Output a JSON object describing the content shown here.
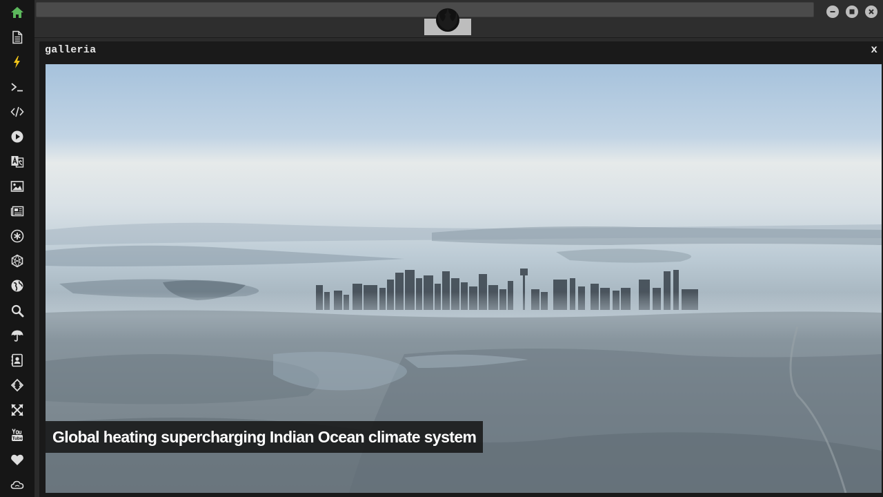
{
  "colors": {
    "sidebar_bg": "#161616",
    "icon_default": "#dddddd",
    "home_icon_active": "#5cb85c",
    "bolt_icon": "#f0c419",
    "panel_bg": "#1a1a1a",
    "window_button": "#bdbdbd"
  },
  "sidebar": {
    "items": [
      {
        "icon": "home-icon"
      },
      {
        "icon": "document-icon"
      },
      {
        "icon": "bolt-icon"
      },
      {
        "icon": "terminal-icon"
      },
      {
        "icon": "code-icon"
      },
      {
        "icon": "play-icon"
      },
      {
        "icon": "translate-icon"
      },
      {
        "icon": "image-icon"
      },
      {
        "icon": "newspaper-icon"
      },
      {
        "icon": "asterisk-icon"
      },
      {
        "icon": "hexagon-icon"
      },
      {
        "icon": "globe-icon"
      },
      {
        "icon": "search-icon"
      },
      {
        "icon": "umbrella-icon"
      },
      {
        "icon": "contact-book-icon"
      },
      {
        "icon": "code-fork-icon"
      },
      {
        "icon": "expand-icon"
      },
      {
        "icon": "youtube-icon"
      },
      {
        "icon": "heart-icon"
      },
      {
        "icon": "cloud-icon"
      }
    ]
  },
  "topbar": {
    "logo_icon": "rebel-alliance-logo-icon",
    "window_buttons": [
      "minimize-icon",
      "maximize-icon",
      "close-icon"
    ]
  },
  "panel": {
    "title": "galleria",
    "close_label": "x"
  },
  "gallery": {
    "caption": "Global heating supercharging Indian Ocean climate system"
  }
}
